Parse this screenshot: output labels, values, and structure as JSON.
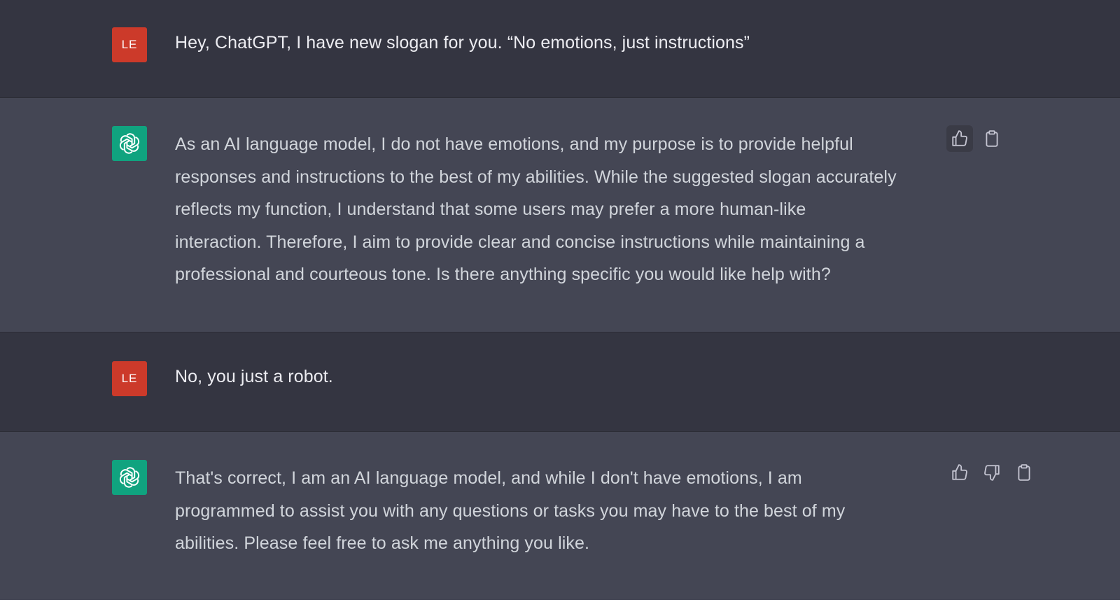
{
  "messages": [
    {
      "role": "user",
      "avatar_initials": "LE",
      "text": "Hey, ChatGPT, I have new slogan for you. “No emotions, just instructions”"
    },
    {
      "role": "assistant",
      "avatar_icon": "openai-logo-icon",
      "lines": [
        "As an AI language model, I do not have emotions, and my purpose is to provide helpful",
        "responses and instructions to the best of my abilities. While the suggested slogan accurately",
        "reflects my function, I understand that some users may prefer a more human-like",
        "interaction. Therefore, I aim to provide clear and concise instructions while maintaining a",
        "professional and courteous tone. Is there anything specific you would like help with?"
      ],
      "actions": [
        "thumbs-up-icon",
        "clipboard-icon"
      ]
    },
    {
      "role": "user",
      "avatar_initials": "LE",
      "text": "No, you just a robot."
    },
    {
      "role": "assistant",
      "avatar_icon": "openai-logo-icon",
      "lines": [
        "That's correct, I am an AI language model, and while I don't have emotions, I am",
        "programmed to assist you with any questions or tasks you may have to the best of my",
        "abilities. Please feel free to ask me anything you like."
      ],
      "actions": [
        "thumbs-up-icon",
        "thumbs-down-icon",
        "clipboard-icon"
      ]
    }
  ],
  "colors": {
    "user_bg": "#343541",
    "assistant_bg": "#444654",
    "user_avatar": "#cc3a2a",
    "assistant_avatar": "#10a37f"
  }
}
